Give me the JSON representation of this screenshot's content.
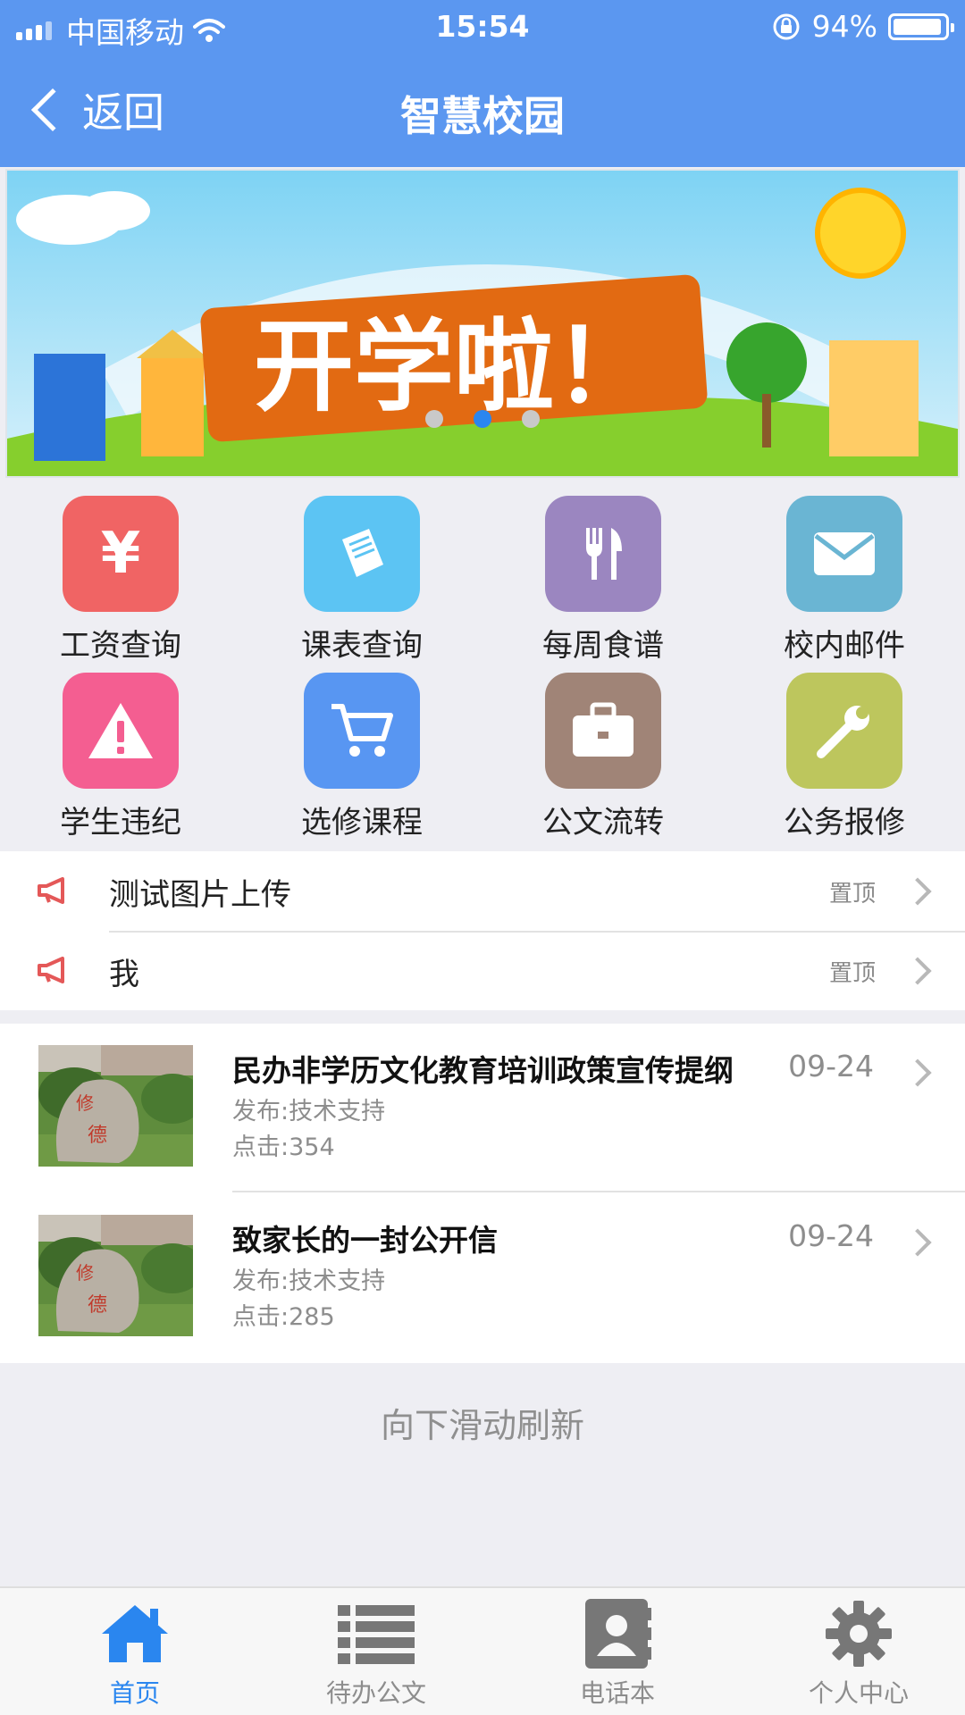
{
  "status_bar": {
    "carrier": "中国移动",
    "time": "15:54",
    "battery": "94%",
    "battery_level": 0.94
  },
  "nav": {
    "back_label": "返回",
    "title": "智慧校园"
  },
  "banner": {
    "headline": "开学啦！",
    "slide_count": 3,
    "active_slide": 1
  },
  "grid": [
    {
      "label": "工资查询",
      "icon": "yen-icon",
      "color": "#f06464"
    },
    {
      "label": "课表查询",
      "icon": "book-icon",
      "color": "#5cc4f3"
    },
    {
      "label": "每周食谱",
      "icon": "fork-knife-icon",
      "color": "#9b86c0"
    },
    {
      "label": "校内邮件",
      "icon": "mail-icon",
      "color": "#6ab5d3"
    },
    {
      "label": "学生违纪",
      "icon": "warning-icon",
      "color": "#f45e91"
    },
    {
      "label": "选修课程",
      "icon": "cart-icon",
      "color": "#5896f2"
    },
    {
      "label": "公文流转",
      "icon": "briefcase-icon",
      "color": "#a08477"
    },
    {
      "label": "公务报修",
      "icon": "wrench-icon",
      "color": "#bdc65d"
    }
  ],
  "notices": [
    {
      "text": "测试图片上传",
      "pin": "置顶"
    },
    {
      "text": "我",
      "pin": "置顶"
    }
  ],
  "news": [
    {
      "title": "民办非学历文化教育培训政策宣传提纲",
      "date": "09-24",
      "publisher": "发布:技术支持",
      "clicks": "点击:354"
    },
    {
      "title": "致家长的一封公开信",
      "date": "09-24",
      "publisher": "发布:技术支持",
      "clicks": "点击:285"
    }
  ],
  "refresh_hint": "向下滑动刷新",
  "tabbar": [
    {
      "label": "首页",
      "icon": "home-icon",
      "active": true
    },
    {
      "label": "待办公文",
      "icon": "list-icon",
      "active": false
    },
    {
      "label": "电话本",
      "icon": "contact-book-icon",
      "active": false
    },
    {
      "label": "个人中心",
      "icon": "gear-icon",
      "active": false
    }
  ],
  "colors": {
    "header": "#5b97f0",
    "accent": "#2a86ef",
    "megaphone": "#e45858"
  }
}
